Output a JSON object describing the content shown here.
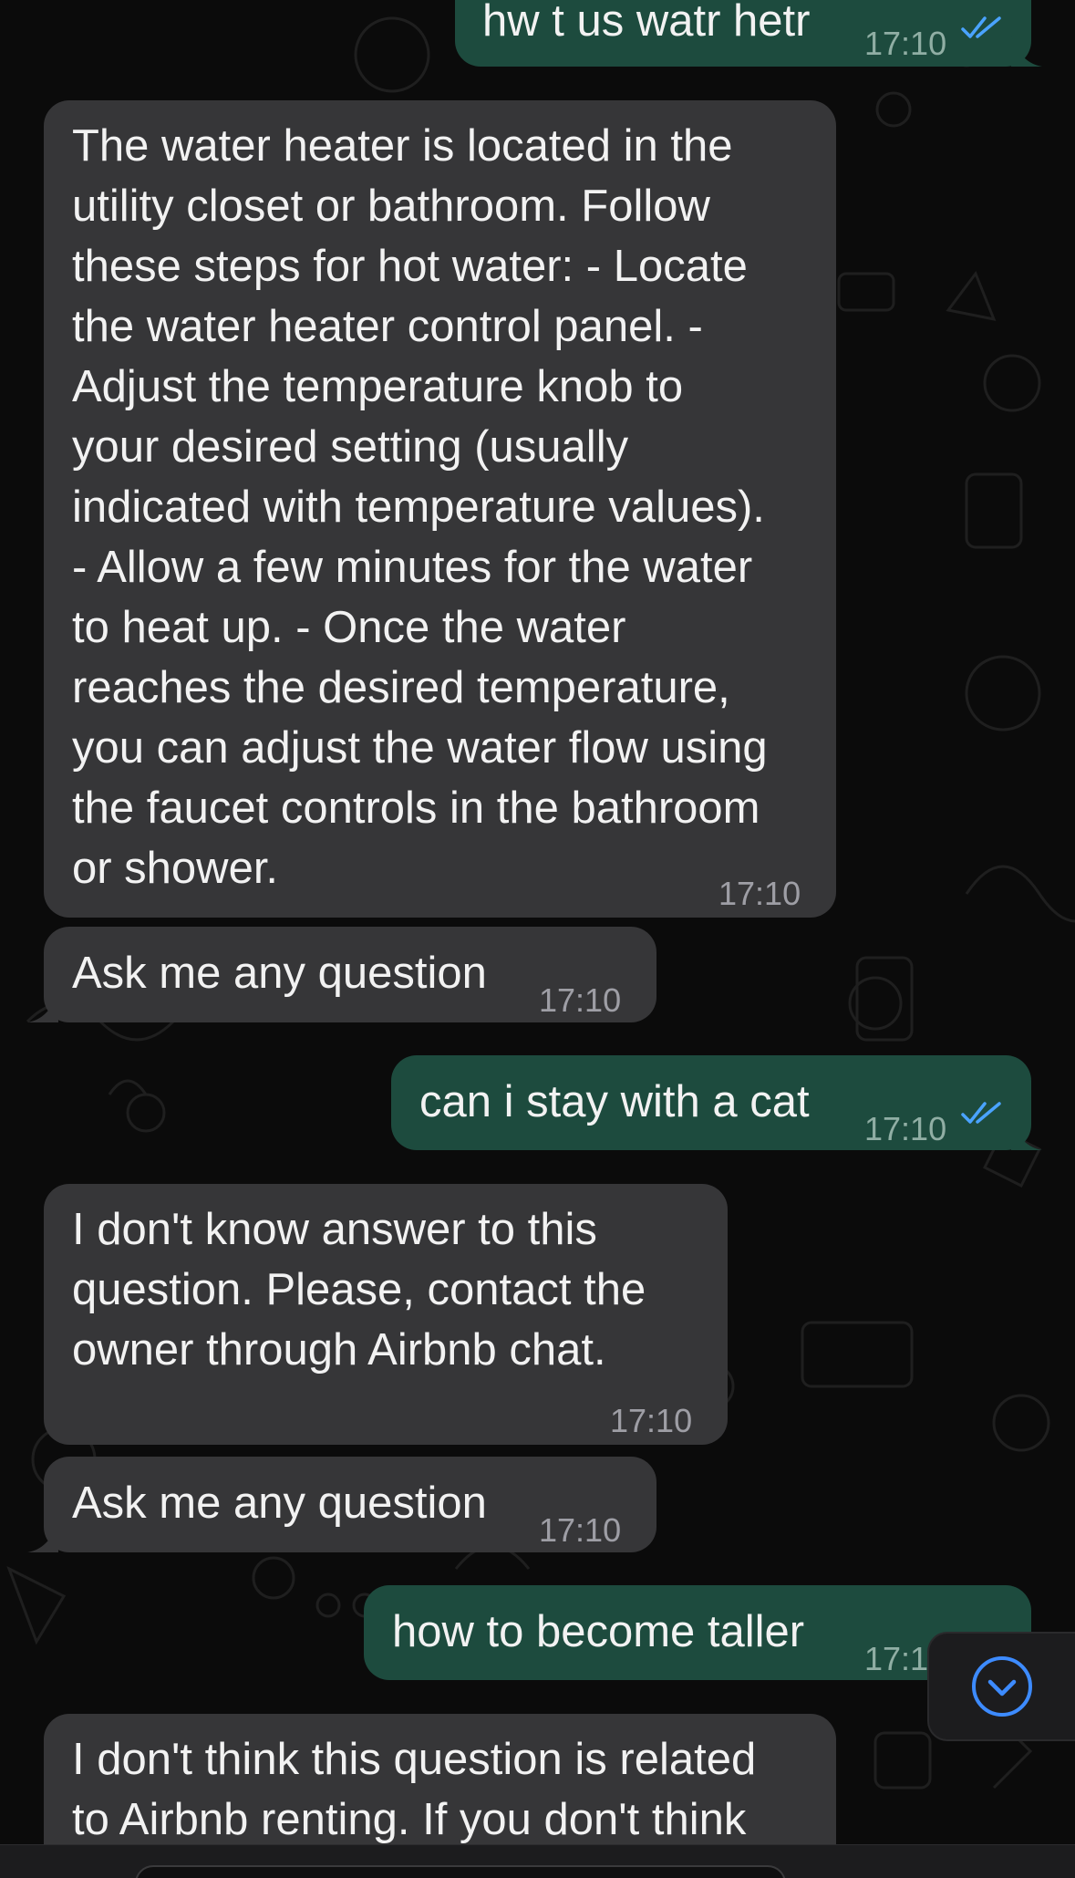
{
  "chat": {
    "messages": [
      {
        "id": "m1",
        "direction": "outgoing",
        "text": "hw t us watr hetr",
        "time": "17:10",
        "status": "read"
      },
      {
        "id": "m2",
        "direction": "incoming",
        "lines": [
          "The water heater is located in the",
          "utility closet or bathroom. Follow",
          "these steps for hot water: - Locate",
          "the water heater control panel. -",
          "Adjust the temperature knob to",
          "your desired setting (usually",
          "indicated with temperature values).",
          "- Allow a few minutes for the water",
          "to heat up. - Once the water",
          "reaches the desired temperature,",
          "you can adjust the water flow using",
          "the faucet controls in the bathroom",
          "or shower."
        ],
        "time": "17:10"
      },
      {
        "id": "m3",
        "direction": "incoming",
        "text": "Ask me any question",
        "time": "17:10"
      },
      {
        "id": "m4",
        "direction": "outgoing",
        "text": "can i stay with a cat",
        "time": "17:10",
        "status": "read"
      },
      {
        "id": "m5",
        "direction": "incoming",
        "lines": [
          "I don't know answer to this",
          "question. Please, contact the",
          "owner through Airbnb chat."
        ],
        "time": "17:10"
      },
      {
        "id": "m6",
        "direction": "incoming",
        "text": "Ask me any question",
        "time": "17:10"
      },
      {
        "id": "m7",
        "direction": "outgoing",
        "text": "how to become taller",
        "time": "17:1",
        "status": "read"
      },
      {
        "id": "m8",
        "direction": "incoming",
        "lines": [
          "I don't think this question is related",
          "to Airbnb renting. If you don't think"
        ]
      }
    ],
    "scroll_button": {
      "icon": "chevron-down-circle-icon"
    },
    "colors": {
      "background": "#0b0b0b",
      "incoming_bubble": "#363638",
      "outgoing_bubble": "#1d4b3e",
      "read_tick": "#4aa3ff",
      "scroll_icon": "#3d8bff"
    }
  }
}
